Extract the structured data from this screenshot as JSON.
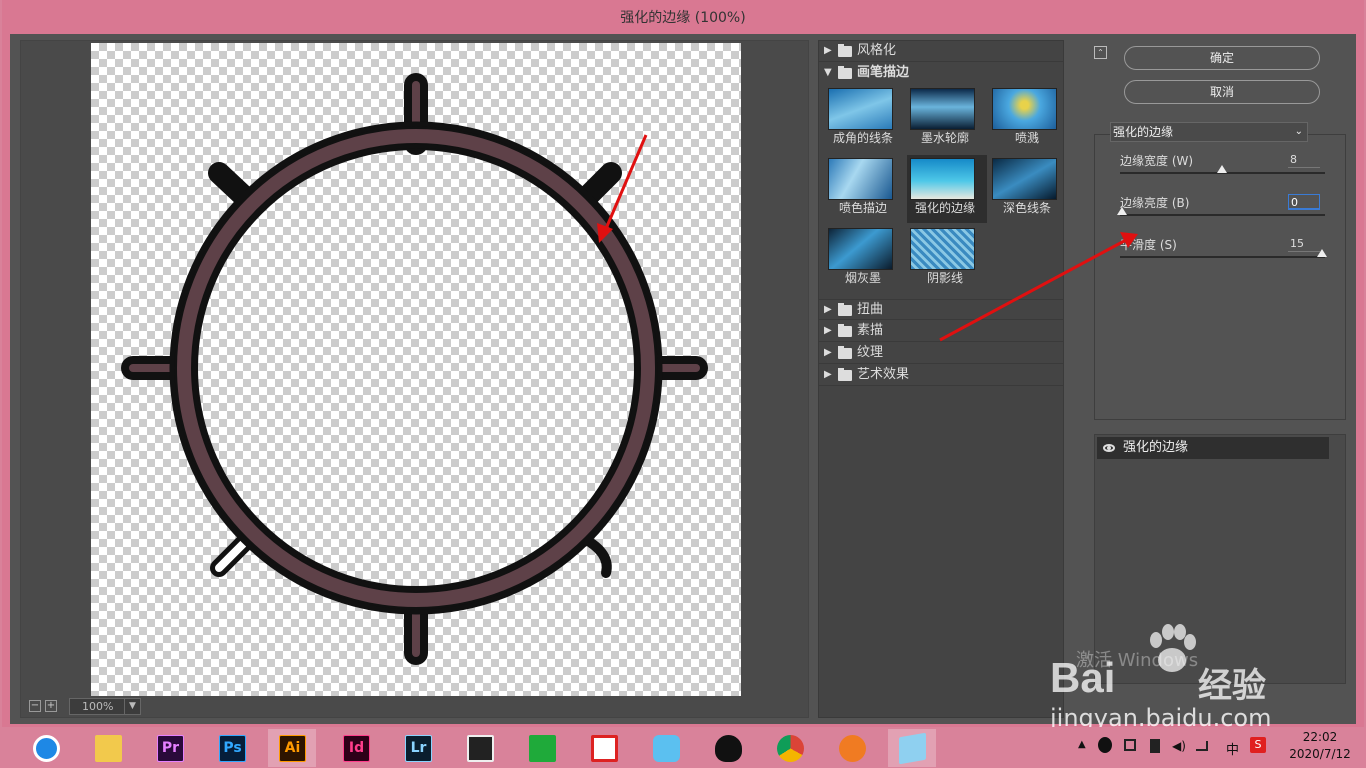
{
  "window": {
    "title": "强化的边缘 (100%)"
  },
  "preview": {
    "zoom": "100%"
  },
  "gallery": {
    "categories_top": [
      {
        "label": "风格化"
      }
    ],
    "open_category": {
      "label": "画笔描边"
    },
    "thumbnails": [
      {
        "label": "成角的线条"
      },
      {
        "label": "墨水轮廓"
      },
      {
        "label": "喷溅"
      },
      {
        "label": "喷色描边"
      },
      {
        "label": "强化的边缘"
      },
      {
        "label": "深色线条"
      },
      {
        "label": "烟灰墨"
      },
      {
        "label": "阴影线"
      }
    ],
    "categories_bottom": [
      {
        "label": "扭曲"
      },
      {
        "label": "素描"
      },
      {
        "label": "纹理"
      },
      {
        "label": "艺术效果"
      }
    ]
  },
  "controls": {
    "ok_label": "确定",
    "cancel_label": "取消",
    "filter_select": "强化的边缘",
    "params": [
      {
        "label": "边缘宽度 (W)",
        "value": "8",
        "fraction": 0.5
      },
      {
        "label": "边缘亮度 (B)",
        "value": "0",
        "fraction": 0.0
      },
      {
        "label": "平滑度 (S)",
        "value": "15",
        "fraction": 1.0
      }
    ],
    "layer_name": "强化的边缘"
  },
  "watermark": {
    "line1": "激活 Windows",
    "site": "jingyan.baidu.com",
    "brand": "Bai",
    "brand2": "经验"
  },
  "taskbar": {
    "apps": [
      {
        "name": "browser-icon",
        "label": ""
      },
      {
        "name": "file-explorer-icon",
        "label": ""
      },
      {
        "name": "premiere-icon",
        "label": "Pr"
      },
      {
        "name": "photoshop-icon",
        "label": "Ps"
      },
      {
        "name": "illustrator-icon",
        "label": "Ai"
      },
      {
        "name": "indesign-icon",
        "label": "Id"
      },
      {
        "name": "lightroom-icon",
        "label": "Lr"
      },
      {
        "name": "video-editor-icon",
        "label": ""
      },
      {
        "name": "green-app-icon",
        "label": ""
      },
      {
        "name": "red-green-app-icon",
        "label": ""
      },
      {
        "name": "bird-app-icon",
        "label": ""
      },
      {
        "name": "qq-icon",
        "label": ""
      },
      {
        "name": "chrome-icon",
        "label": ""
      },
      {
        "name": "orange-app-icon",
        "label": ""
      },
      {
        "name": "blue-app-icon",
        "label": ""
      }
    ],
    "ime": "中",
    "time": "22:02",
    "date": "2020/7/12"
  },
  "colors": {
    "accent": "#d9829a",
    "panel": "#535353",
    "ring_fill": "#5e4148"
  }
}
